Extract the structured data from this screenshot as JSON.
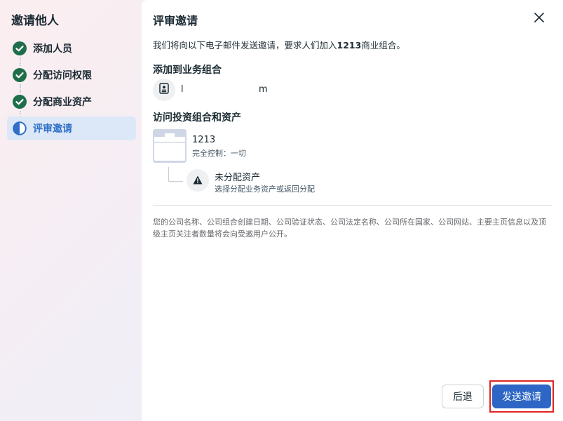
{
  "sidebar": {
    "title": "邀请他人",
    "steps": [
      {
        "label": "添加人员",
        "status": "done"
      },
      {
        "label": "分配访问权限",
        "status": "done"
      },
      {
        "label": "分配商业资产",
        "status": "done"
      },
      {
        "label": "评审邀请",
        "status": "current"
      }
    ]
  },
  "panel": {
    "title": "评审邀请",
    "intro_prefix": "我们将向以下电子邮件发送邀请，要求人们加入",
    "intro_bold": "1213",
    "intro_suffix": "商业组合。",
    "section_add_title": "添加到业务组合",
    "person_email": "l                          m",
    "section_access_title": "访问投资组合和资产",
    "portfolio": {
      "name": "1213",
      "permission": "完全控制：一切"
    },
    "unassigned": {
      "title": "未分配资产",
      "desc": "选择分配业务资产或返回分配"
    },
    "disclaimer": "您的公司名称、公司组合创建日期、公司验证状态、公司法定名称、公司所在国家、公司网站、主要主页信息以及顶级主页关注者数量将会向受邀用户公开。"
  },
  "buttons": {
    "back": "后退",
    "send": "发送邀请"
  },
  "colors": {
    "accent": "#2d66c4",
    "done": "#1f6e4a",
    "highlight": "#e02424"
  },
  "icons": {
    "close": "close-icon",
    "done": "check-circle-icon",
    "current": "half-circle-icon",
    "person": "id-badge-icon",
    "warning": "warning-icon"
  }
}
